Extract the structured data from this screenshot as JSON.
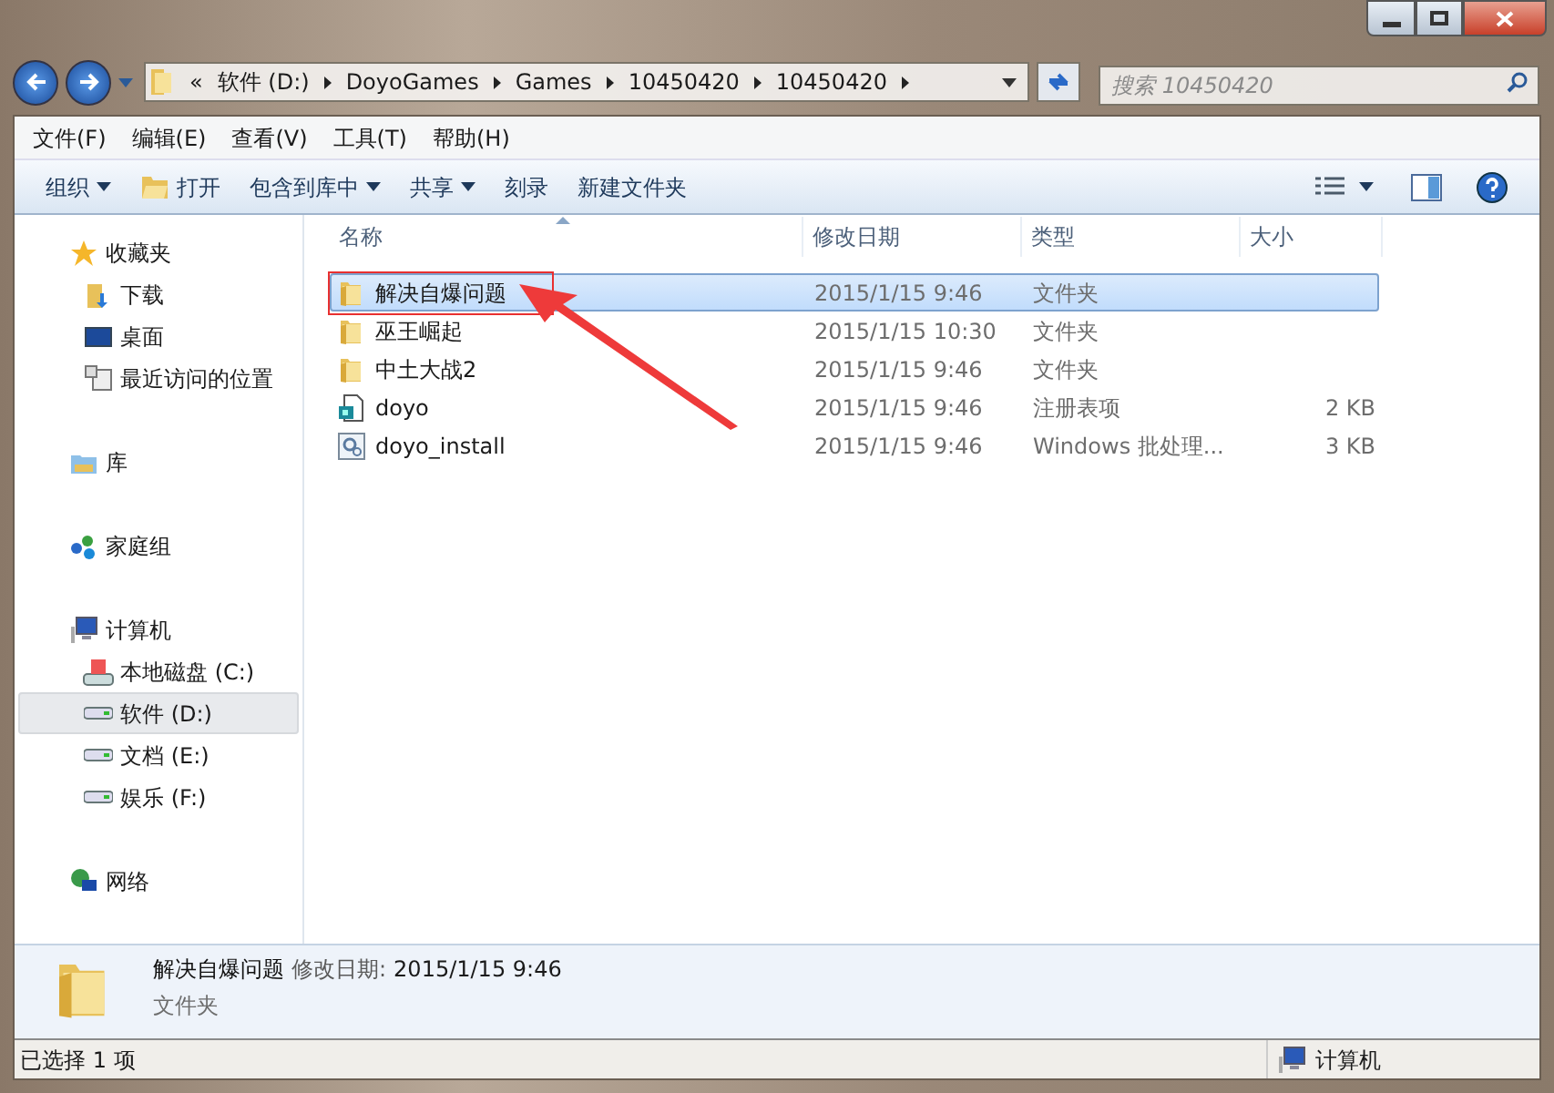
{
  "address": {
    "crumbs": [
      "«",
      "软件 (D:)",
      "DoyoGames",
      "Games",
      "10450420",
      "10450420"
    ]
  },
  "search": {
    "placeholder": "搜索 10450420"
  },
  "menu": [
    "文件(F)",
    "编辑(E)",
    "查看(V)",
    "工具(T)",
    "帮助(H)"
  ],
  "toolbar": [
    {
      "label": "组织",
      "kind": "dropdown"
    },
    {
      "label": "打开",
      "kind": "open"
    },
    {
      "label": "包含到库中",
      "kind": "dropdown"
    },
    {
      "label": "共享",
      "kind": "dropdown"
    },
    {
      "label": "刻录",
      "kind": "plain"
    },
    {
      "label": "新建文件夹",
      "kind": "plain"
    }
  ],
  "sidebar": [
    {
      "label": "收藏夹",
      "kind": "star",
      "selected": false,
      "children": [
        {
          "label": "下载",
          "kind": "download",
          "selected": false
        },
        {
          "label": "桌面",
          "kind": "desktop",
          "selected": false
        },
        {
          "label": "最近访问的位置",
          "kind": "recent",
          "selected": false
        }
      ]
    },
    {
      "label": "库",
      "kind": "library",
      "selected": false
    },
    {
      "label": "家庭组",
      "kind": "homegroup",
      "selected": false
    },
    {
      "label": "计算机",
      "kind": "computer",
      "selected": false,
      "children": [
        {
          "label": "本地磁盘 (C:)",
          "kind": "sysdrive",
          "selected": false
        },
        {
          "label": "软件 (D:)",
          "kind": "drive",
          "selected": true
        },
        {
          "label": "文档 (E:)",
          "kind": "drive",
          "selected": false
        },
        {
          "label": "娱乐 (F:)",
          "kind": "drive",
          "selected": false
        }
      ]
    },
    {
      "label": "网络",
      "kind": "network",
      "selected": false
    }
  ],
  "table": {
    "columns": [
      "名称",
      "修改日期",
      "类型",
      "大小"
    ],
    "rows": [
      {
        "name": "解决自爆问题",
        "date": "2015/1/15 9:46",
        "type": "文件夹",
        "size": "",
        "kind": "folder",
        "selected": true,
        "annotated": true
      },
      {
        "name": "巫王崛起",
        "date": "2015/1/15 10:30",
        "type": "文件夹",
        "size": "",
        "kind": "folder",
        "selected": false,
        "annotated": false
      },
      {
        "name": "中土大战2",
        "date": "2015/1/15 9:46",
        "type": "文件夹",
        "size": "",
        "kind": "folder",
        "selected": false,
        "annotated": false
      },
      {
        "name": "doyo",
        "date": "2015/1/15 9:46",
        "type": "注册表项",
        "size": "2 KB",
        "kind": "registry",
        "selected": false,
        "annotated": false
      },
      {
        "name": "doyo_install",
        "date": "2015/1/15 9:46",
        "type": "Windows 批处理...",
        "size": "3 KB",
        "kind": "batch",
        "selected": false,
        "annotated": false
      }
    ]
  },
  "details": {
    "name": "解决自爆问题",
    "date_label": "修改日期:",
    "date": "2015/1/15 9:46",
    "type": "文件夹"
  },
  "status_bar": {
    "selection": "已选择 1 项",
    "location": "计算机"
  }
}
